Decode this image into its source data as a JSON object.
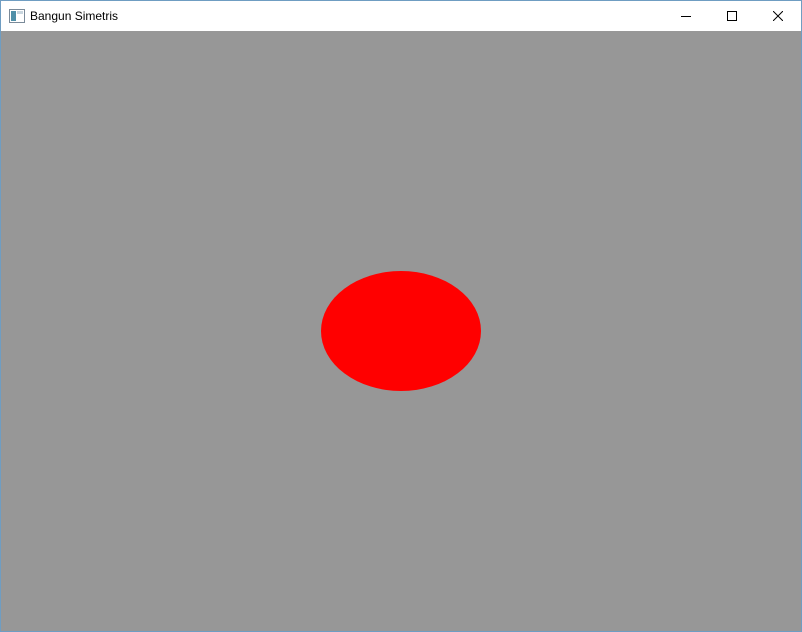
{
  "window": {
    "title": "Bangun Simetris",
    "icon": "app-window-icon",
    "controls": [
      "minimize-icon",
      "maximize-icon",
      "close-icon"
    ]
  },
  "canvas": {
    "background_color": "#979797",
    "shape": {
      "type": "ellipse",
      "fill_color": "#ff0000"
    }
  }
}
